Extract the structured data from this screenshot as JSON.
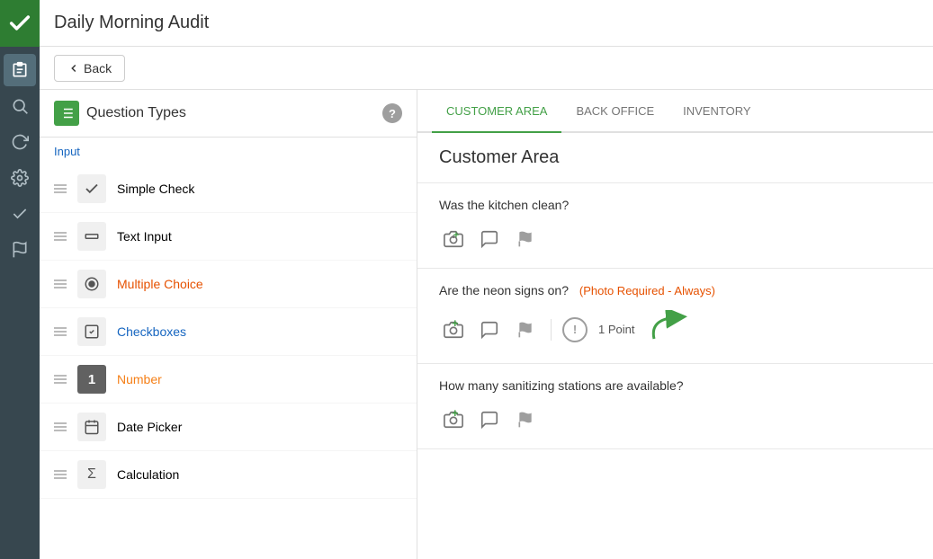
{
  "header": {
    "title": "Daily Morning Audit"
  },
  "toolbar": {
    "back_label": "Back"
  },
  "left_panel": {
    "title": "Question Types",
    "input_label": "Input",
    "items": [
      {
        "id": "simple-check",
        "label": "Simple Check",
        "icon": "✓",
        "label_class": ""
      },
      {
        "id": "text-input",
        "label": "Text Input",
        "icon": "▭",
        "label_class": ""
      },
      {
        "id": "multiple-choice",
        "label": "Multiple Choice",
        "icon": "◎",
        "label_class": "orange"
      },
      {
        "id": "checkboxes",
        "label": "Checkboxes",
        "icon": "☑",
        "label_class": "blue"
      },
      {
        "id": "number",
        "label": "Number",
        "icon": "1",
        "label_class": "amber"
      },
      {
        "id": "date-picker",
        "label": "Date Picker",
        "icon": "📅",
        "label_class": ""
      },
      {
        "id": "calculation",
        "label": "Calculation",
        "icon": "Σ",
        "label_class": ""
      }
    ]
  },
  "tabs": [
    {
      "id": "customer-area",
      "label": "CUSTOMER AREA",
      "active": true
    },
    {
      "id": "back-office",
      "label": "BACK OFFICE",
      "active": false
    },
    {
      "id": "inventory",
      "label": "INVENTORY",
      "active": false
    }
  ],
  "section": {
    "title": "Customer Area",
    "questions": [
      {
        "id": "q1",
        "text": "Was the kitchen clean?",
        "highlight": "",
        "has_points": false,
        "points_value": ""
      },
      {
        "id": "q2",
        "text": "Are the neon signs on?",
        "highlight": "(Photo Required - Always)",
        "has_points": true,
        "points_value": "1 Point"
      },
      {
        "id": "q3",
        "text": "How many sanitizing stations are available?",
        "highlight": "",
        "has_points": false,
        "points_value": ""
      }
    ]
  },
  "sidebar": {
    "items": [
      {
        "id": "clipboard",
        "icon": "📋",
        "active": true
      },
      {
        "id": "search",
        "icon": "🔍",
        "active": false
      },
      {
        "id": "refresh",
        "icon": "↻",
        "active": false
      },
      {
        "id": "settings",
        "icon": "⚙",
        "active": false
      },
      {
        "id": "check",
        "icon": "✔",
        "active": false
      },
      {
        "id": "flag",
        "icon": "⚑",
        "active": false
      }
    ]
  },
  "colors": {
    "green": "#43a047",
    "sidebar_bg": "#37474f",
    "orange": "#e65100",
    "blue": "#1565c0",
    "amber": "#f57f17"
  }
}
